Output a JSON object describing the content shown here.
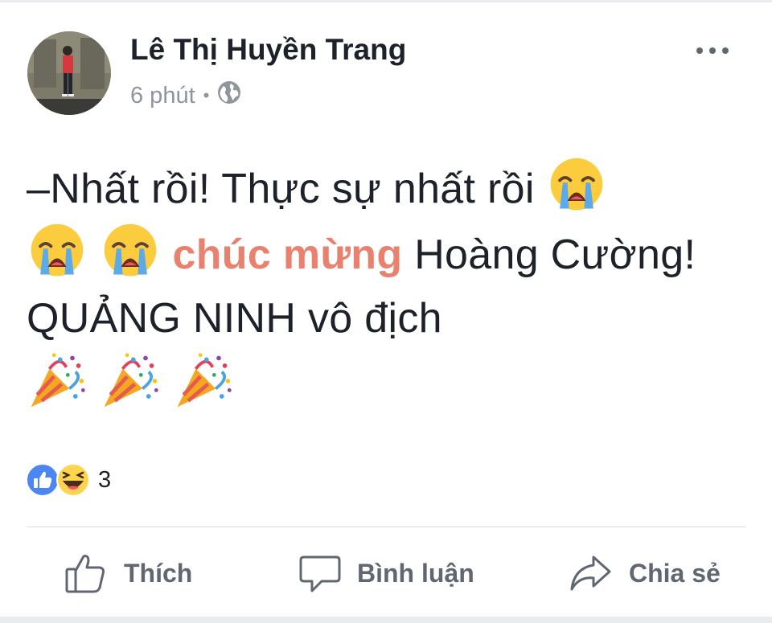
{
  "post": {
    "author_name": "Lê Thị Huyền Trang",
    "timestamp": "6 phút",
    "separator": "•",
    "privacy_icon": "globe-icon",
    "text": {
      "part1": "–Nhất rồi! Thực sự nhất rồi",
      "highlight": "chúc mừng",
      "part2": "Hoàng Cường! QUẢNG NINH vô địch"
    },
    "emojis": [
      "loudly-crying-face",
      "loudly-crying-face",
      "loudly-crying-face",
      "party-popper",
      "party-popper",
      "party-popper"
    ]
  },
  "reactions": {
    "icons": [
      "like-icon",
      "haha-icon"
    ],
    "count": "3"
  },
  "actions": {
    "like_label": "Thích",
    "comment_label": "Bình luận",
    "share_label": "Chia sẻ"
  },
  "colors": {
    "highlight": "#e9816f",
    "like_blue": "#4b86f3",
    "muted_text": "#90949c"
  }
}
